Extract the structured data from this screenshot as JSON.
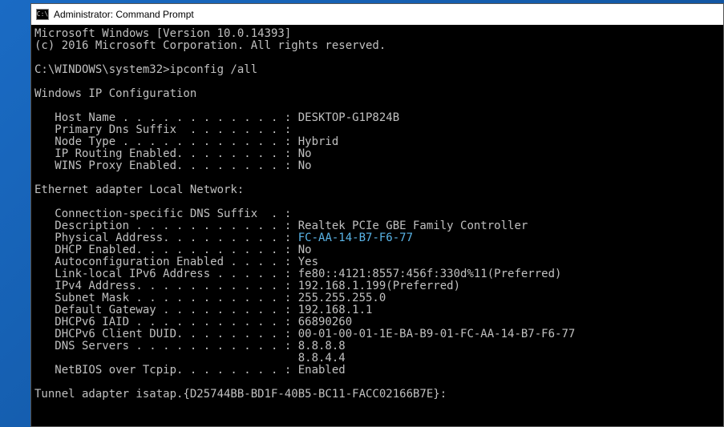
{
  "window": {
    "icon_text": "C:\\",
    "title": "Administrator: Command Prompt"
  },
  "header": {
    "version_line": "Microsoft Windows [Version 10.0.14393]",
    "copyright_line": "(c) 2016 Microsoft Corporation. All rights reserved."
  },
  "prompt": {
    "path": "C:\\WINDOWS\\system32>",
    "command": "ipconfig /all"
  },
  "section1": {
    "title": "Windows IP Configuration",
    "host_name": "   Host Name . . . . . . . . . . . . : DESKTOP-G1P824B",
    "primary_dns": "   Primary Dns Suffix  . . . . . . . :",
    "node_type": "   Node Type . . . . . . . . . . . . : Hybrid",
    "ip_routing": "   IP Routing Enabled. . . . . . . . : No",
    "wins_proxy": "   WINS Proxy Enabled. . . . . . . . : No"
  },
  "section2": {
    "title": "Ethernet adapter Local Network:",
    "conn_suffix": "   Connection-specific DNS Suffix  . :",
    "description": "   Description . . . . . . . . . . . : Realtek PCIe GBE Family Controller",
    "phys_addr_label": "   Physical Address. . . . . . . . . : ",
    "phys_addr_value": "FC-AA-14-B7-F6-77",
    "dhcp_enabled": "   DHCP Enabled. . . . . . . . . . . : No",
    "autoconfig": "   Autoconfiguration Enabled . . . . : Yes",
    "link_local_ipv6": "   Link-local IPv6 Address . . . . . : fe80::4121:8557:456f:330d%11(Preferred)",
    "ipv4": "   IPv4 Address. . . . . . . . . . . : 192.168.1.199(Preferred)",
    "subnet": "   Subnet Mask . . . . . . . . . . . : 255.255.255.0",
    "gateway": "   Default Gateway . . . . . . . . . : 192.168.1.1",
    "dhcpv6_iaid": "   DHCPv6 IAID . . . . . . . . . . . : 66890260",
    "dhcpv6_duid": "   DHCPv6 Client DUID. . . . . . . . : 00-01-00-01-1E-BA-B9-01-FC-AA-14-B7-F6-77",
    "dns1": "   DNS Servers . . . . . . . . . . . : 8.8.8.8",
    "dns2": "                                       8.8.4.4",
    "netbios": "   NetBIOS over Tcpip. . . . . . . . : Enabled"
  },
  "section3": {
    "title": "Tunnel adapter isatap.{D25744BB-BD1F-40B5-BC11-FACC02166B7E}:"
  }
}
